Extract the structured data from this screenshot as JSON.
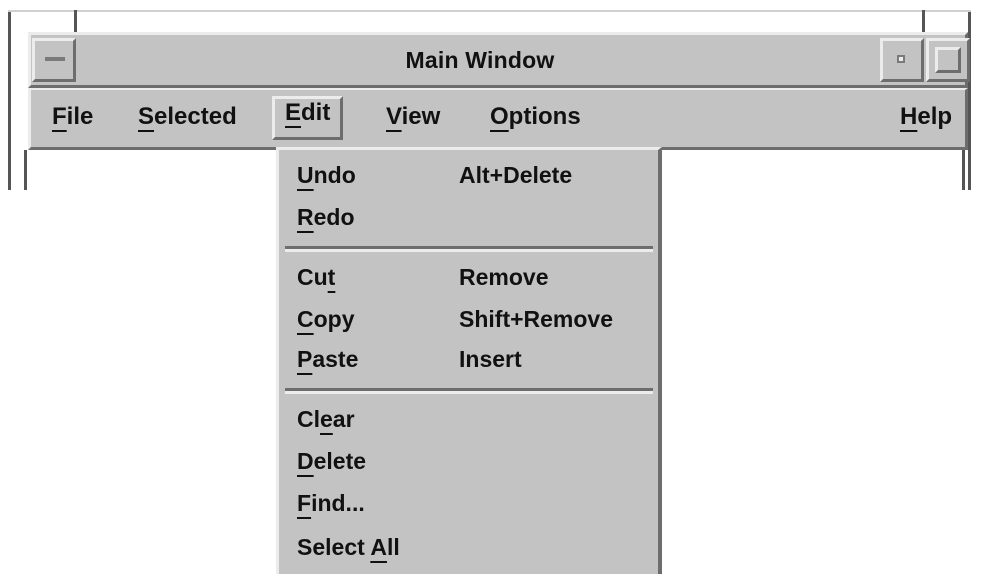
{
  "window": {
    "title": "Main Window"
  },
  "menubar": {
    "items": [
      {
        "label": "File",
        "mnemonic": "F"
      },
      {
        "label": "Selected",
        "mnemonic": "S"
      },
      {
        "label": "Edit",
        "mnemonic": "E"
      },
      {
        "label": "View",
        "mnemonic": "V"
      },
      {
        "label": "Options",
        "mnemonic": "O"
      },
      {
        "label": "Help",
        "mnemonic": "H"
      }
    ],
    "active": "Edit"
  },
  "edit_menu": {
    "items": [
      {
        "label": "Undo",
        "accelerator": "Alt+Delete"
      },
      {
        "label": "Redo",
        "accelerator": ""
      },
      {
        "label": "Cut",
        "accelerator": "Remove"
      },
      {
        "label": "Copy",
        "accelerator": "Shift+Remove"
      },
      {
        "label": "Paste",
        "accelerator": "Insert"
      },
      {
        "label": "Clear",
        "accelerator": ""
      },
      {
        "label": "Delete",
        "accelerator": ""
      },
      {
        "label": "Find...",
        "accelerator": ""
      },
      {
        "label": "Select All",
        "accelerator": ""
      }
    ]
  },
  "icons": {
    "window_menu": "minimize-bar-icon",
    "minimize": "minimize-icon",
    "maximize": "maximize-icon"
  },
  "colors": {
    "chrome": "#c3c3c3",
    "highlight": "#ececec",
    "shadow": "#6d6d6d"
  }
}
